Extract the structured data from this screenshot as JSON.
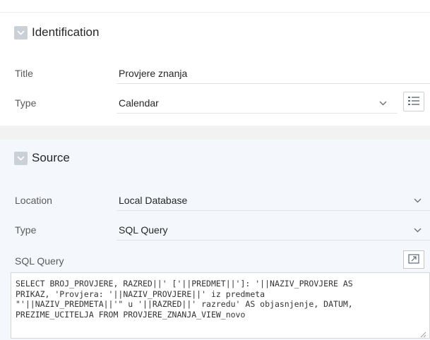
{
  "identification": {
    "title": "Identification",
    "title_label": "Title",
    "title_value": "Provjere znanja",
    "type_label": "Type",
    "type_value": "Calendar"
  },
  "source": {
    "title": "Source",
    "location_label": "Location",
    "location_value": "Local Database",
    "type_label": "Type",
    "type_value": "SQL Query",
    "sql_label": "SQL Query",
    "sql_text": "SELECT BROJ_PROVJERE, RAZRED||' ['||PREDMET||']: '||NAZIV_PROVJERE AS\nPRIKAZ, 'Provjera: '||NAZIV_PROVJERE||' iz predmeta\n\"'||NAZIV_PREDMETA||'\" u '||RAZRED||' razredu' AS objasnjenje, DATUM,\nPREZIME_UCITELJA FROM PROVJERE_ZNANJA_VIEW_novo"
  },
  "icons": {
    "collapse": "chevron-down-icon",
    "select": "chevron-down-icon",
    "list": "list-icon",
    "expand": "expand-editor-icon",
    "resize": "resize-grip-icon"
  }
}
